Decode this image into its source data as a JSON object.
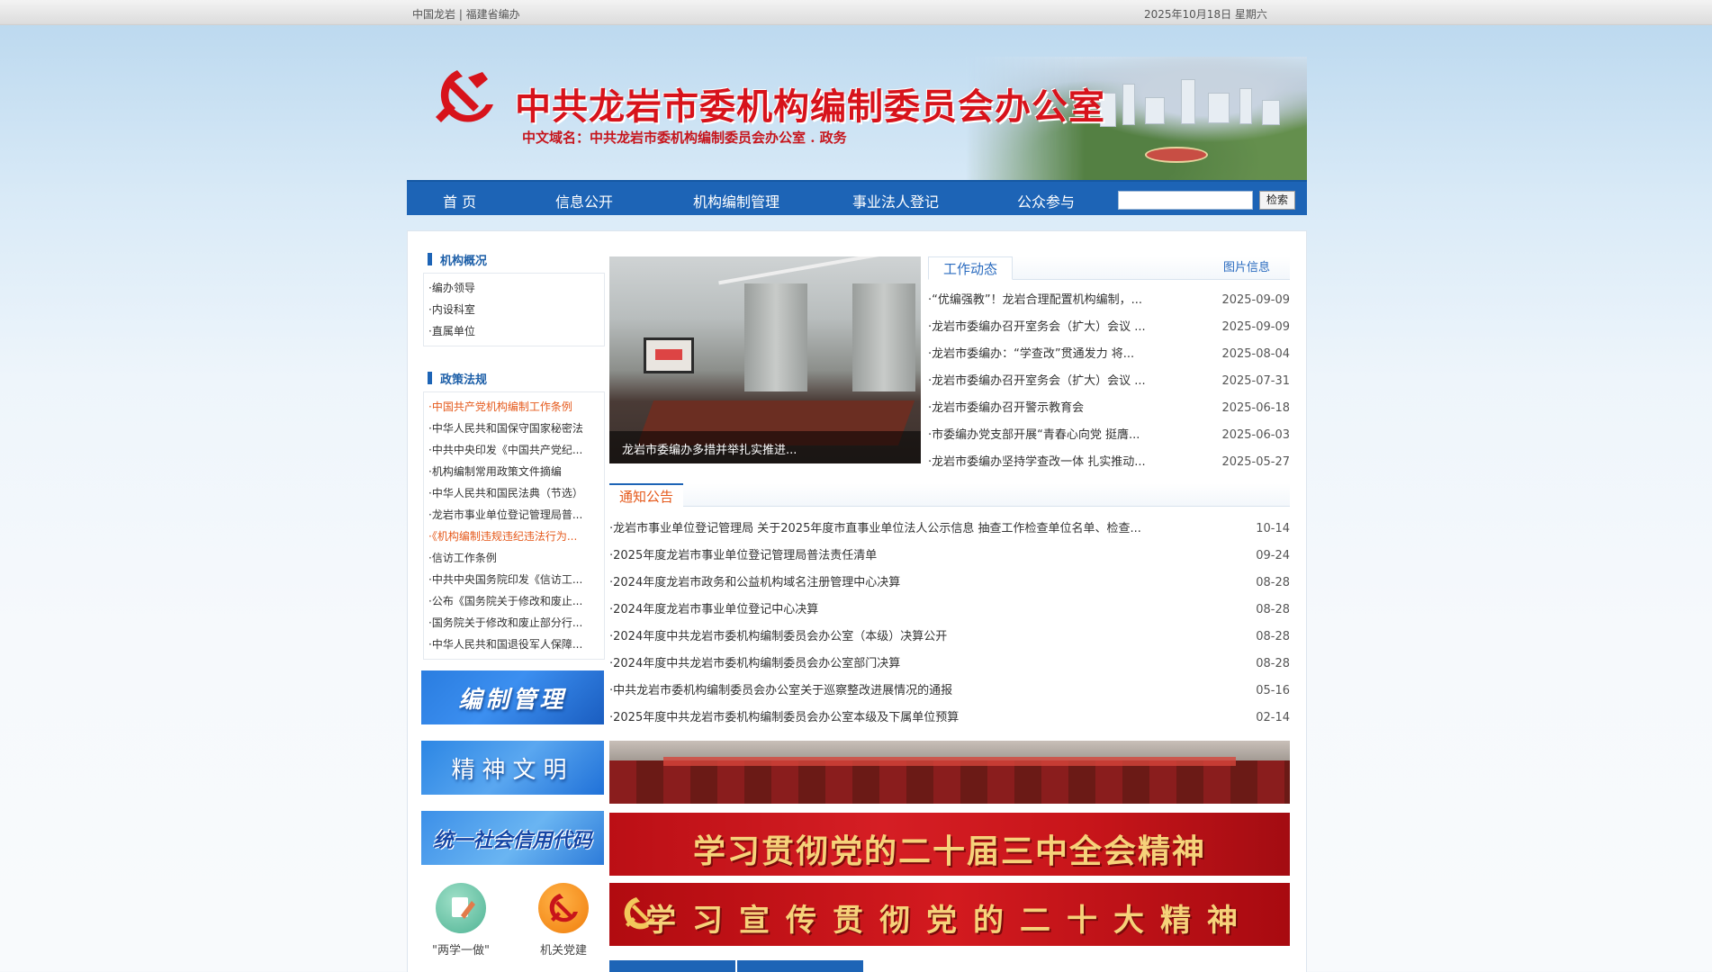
{
  "topbar": {
    "left": "中国龙岩 | 福建省编办",
    "right": "2025年10月18日 星期六"
  },
  "header": {
    "title": "中共龙岩市委机构编制委员会办公室",
    "domain": "中文域名：中共龙岩市委机构编制委员会办公室 . 政务"
  },
  "nav": {
    "items": [
      "首 页",
      "信息公开",
      "机构编制管理",
      "事业法人登记",
      "公众参与"
    ],
    "search_value": "",
    "search_button": "检索"
  },
  "left": {
    "section1_title": "机构概况",
    "section1_items": [
      "·编办领导",
      "·内设科室",
      "·直属单位"
    ],
    "section2_title": "政策法规",
    "section2_items": [
      "·中国共产党机构编制工作条例",
      "·中华人民共和国保守国家秘密法",
      "·中共中央印发《中国共产党纪...",
      "·机构编制常用政策文件摘编",
      "·中华人民共和国民法典（节选）",
      "·龙岩市事业单位登记管理局普...",
      "·《机构编制违规违纪违法行为...",
      "·信访工作条例",
      "·中共中央国务院印发《信访工...",
      "·公布《国务院关于修改和废止...",
      "·国务院关于修改和废止部分行...",
      "·中华人民共和国退役军人保障..."
    ],
    "banners": [
      "编制管理",
      "精神文明",
      "统一社会信用代码"
    ],
    "quick_links": [
      "\"两学一做\"",
      "机关党建"
    ]
  },
  "carousel": {
    "caption": "龙岩市委编办多措并举扎实推进...",
    "dot_count": 5,
    "active_dot": 4
  },
  "news": {
    "tab_active": "工作动态",
    "tab_more": "图片信息",
    "rows": [
      {
        "title": "·“优编强教”！龙岩合理配置机构编制，...",
        "date": "2025-09-09"
      },
      {
        "title": "·龙岩市委编办召开室务会（扩大）会议 ...",
        "date": "2025-09-09"
      },
      {
        "title": "·龙岩市委编办：“学查改”贯通发力 将...",
        "date": "2025-08-04"
      },
      {
        "title": "·龙岩市委编办召开室务会（扩大）会议 ...",
        "date": "2025-07-31"
      },
      {
        "title": "·龙岩市委编办召开警示教育会",
        "date": "2025-06-18"
      },
      {
        "title": "·市委编办党支部开展“青春心向党 挺膺...",
        "date": "2025-06-03"
      },
      {
        "title": "·龙岩市委编办坚持学查改一体 扎实推动...",
        "date": "2025-05-27"
      }
    ]
  },
  "notice": {
    "tab": "通知公告",
    "rows": [
      {
        "title": "·龙岩市事业单位登记管理局 关于2025年度市直事业单位法人公示信息 抽查工作检查单位名单、检查...",
        "date": "10-14"
      },
      {
        "title": "·2025年度龙岩市事业单位登记管理局普法责任清单",
        "date": "09-24"
      },
      {
        "title": "·2024年度龙岩市政务和公益机构域名注册管理中心决算",
        "date": "08-28"
      },
      {
        "title": "·2024年度龙岩市事业单位登记中心决算",
        "date": "08-28"
      },
      {
        "title": "·2024年度中共龙岩市委机构编制委员会办公室（本级）决算公开",
        "date": "08-28"
      },
      {
        "title": "·2024年度中共龙岩市委机构编制委员会办公室部门决算",
        "date": "08-28"
      },
      {
        "title": "·中共龙岩市委机构编制委员会办公室关于巡察整改进展情况的通报",
        "date": "05-16"
      },
      {
        "title": "·2025年度中共龙岩市委机构编制委员会办公室本级及下属单位预算",
        "date": "02-14"
      }
    ]
  },
  "banners": {
    "slogan1": "学习贯彻党的二十届三中全会精神",
    "slogan2": "学习宣传贯彻党的二十大精神"
  },
  "colors": {
    "nav": "#1d64b6",
    "brand_red": "#d7131b",
    "accent_orange": "#e5591b"
  }
}
